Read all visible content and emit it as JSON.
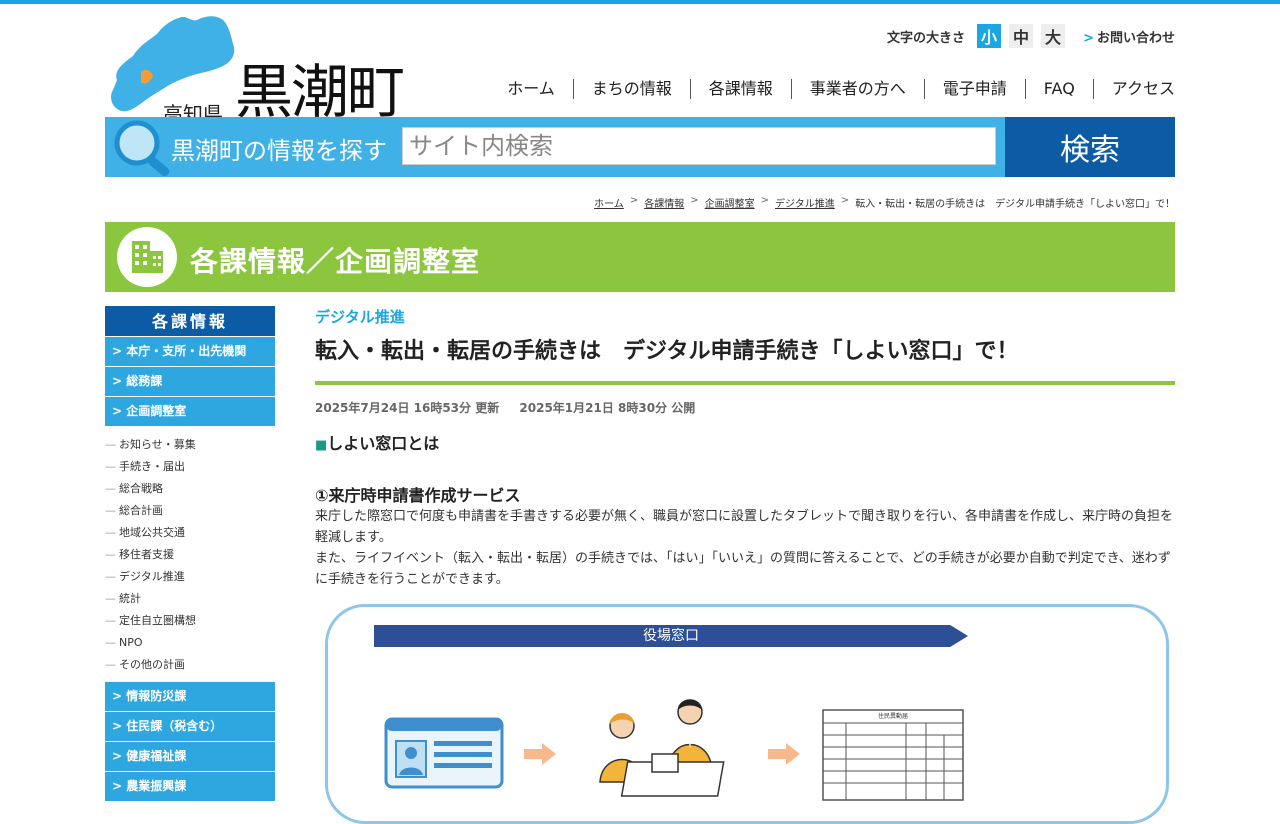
{
  "header": {
    "logo_pref": "高知県",
    "logo_town": "黒潮町",
    "font_size_label": "文字の大きさ",
    "font_sizes": [
      "小",
      "中",
      "大"
    ],
    "font_size_active": "小",
    "contact_label": "お問い合わせ",
    "nav": [
      "ホーム",
      "まちの情報",
      "各課情報",
      "事業者の方へ",
      "電子申請",
      "FAQ",
      "アクセス"
    ]
  },
  "search": {
    "label": "黒潮町の情報を探す",
    "placeholder": "サイト内検索",
    "button": "検索"
  },
  "breadcrumb": [
    "ホーム",
    "各課情報",
    "企画調整室",
    "デジタル推進",
    "転入・転出・転居の手続きは　デジタル申請手続き「しよい窓口」で！"
  ],
  "banner": {
    "title": "各課情報／企画調整室"
  },
  "sidebar": {
    "heading": "各課情報",
    "top_links": [
      "本庁・支所・出先機関",
      "総務課",
      "企画調整室"
    ],
    "sub_links": [
      "お知らせ・募集",
      "手続き・届出",
      "総合戦略",
      "総合計画",
      "地域公共交通",
      "移住者支援",
      "デジタル推進",
      "統計",
      "定住自立圏構想",
      "NPO",
      "その他の計画"
    ],
    "bottom_links": [
      "情報防災課",
      "住民課（税含む）",
      "健康福祉課",
      "農業振興課"
    ]
  },
  "article": {
    "category": "デジタル推進",
    "title": "転入・転出・転居の手続きは　デジタル申請手続き「しよい窓口」で！",
    "updated": "2025年7月24日 16時53分 更新",
    "published": "2025年1月21日 8時30分 公開",
    "h1": "しよい窓口とは",
    "h2": "①来庁時申請書作成サービス",
    "p1": "来庁した際窓口で何度も申請書を手書きする必要が無く、職員が窓口に設置したタブレットで聞き取りを行い、各申請書を作成し、来庁時の負担を軽減します。",
    "p2": "また、ライフイベント（転入・転出・転居）の手続きでは、「はい」「いいえ」の質問に答えることで、どの手続きが必要か自動で判定でき、迷わずに手続きを行うことができます。",
    "figure_banner": "役場窓口",
    "figure_form_title": "住民異動届"
  },
  "colors": {
    "accent_blue": "#1aa6e0",
    "dark_blue": "#0e5ba5",
    "green": "#8cc63f"
  }
}
